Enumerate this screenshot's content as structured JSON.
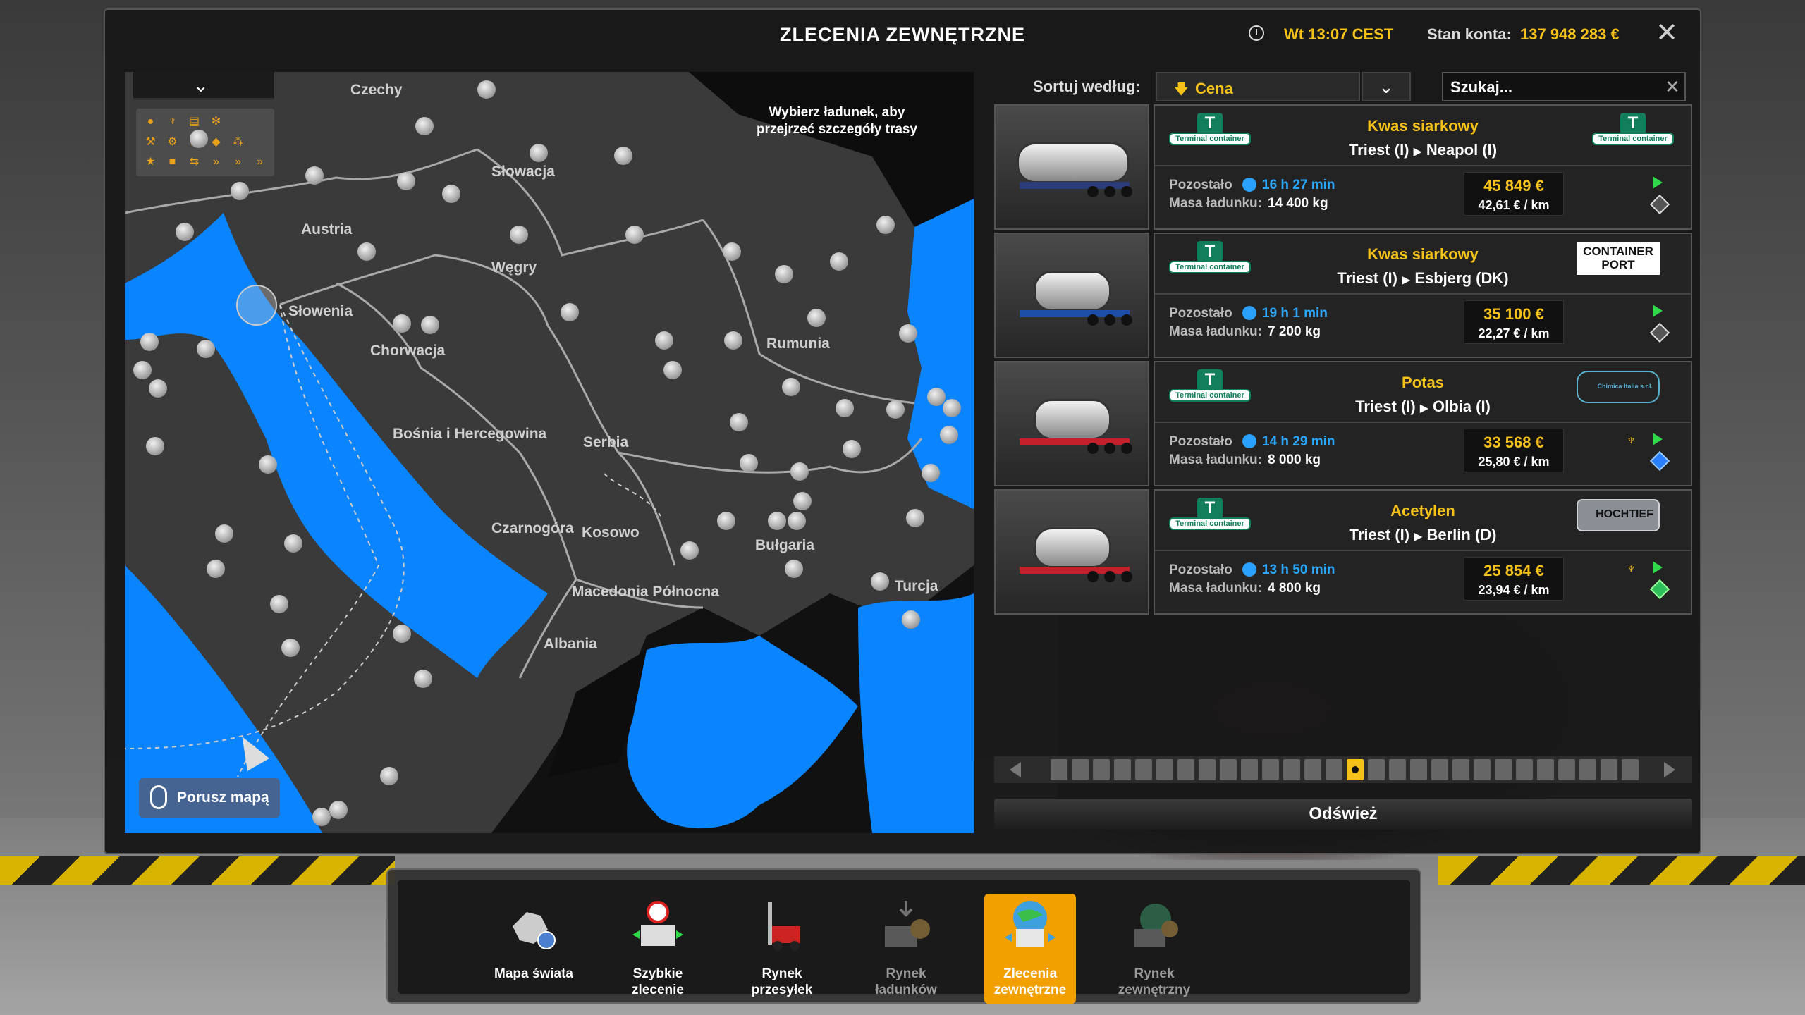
{
  "window": {
    "title": "ZLECENIA ZEWNĘTRZNE",
    "clock": "Wt 13:07 CEST",
    "balance_label": "Stan konta:",
    "balance_value": "137 948 283 €"
  },
  "map": {
    "hint": "Wybierz ładunek, aby przejrzeć szczegóły trasy",
    "move_label": "Porusz mapą",
    "labels": [
      {
        "name": "Czechy"
      },
      {
        "name": "Słowacja"
      },
      {
        "name": "Austria"
      },
      {
        "name": "Węgry"
      },
      {
        "name": "Słowenia"
      },
      {
        "name": "Chorwacja"
      },
      {
        "name": "Rumunia"
      },
      {
        "name": "Bośnia i Hercegowina"
      },
      {
        "name": "Serbia"
      },
      {
        "name": "Czarnogóra"
      },
      {
        "name": "Kosowo"
      },
      {
        "name": "Bułgaria"
      },
      {
        "name": "Macedonia Północna"
      },
      {
        "name": "Turcja"
      },
      {
        "name": "Albania"
      }
    ]
  },
  "sort": {
    "label": "Sortuj według:",
    "value": "Cena"
  },
  "search": {
    "placeholder": "Szukaj..."
  },
  "jobs": [
    {
      "cargo": "Kwas siarkowy",
      "from": "Triest (I)",
      "to": "Neapol (I)",
      "remaining_label": "Pozostało",
      "remaining": "16 h 27 min",
      "mass_label": "Masa ładunku:",
      "mass": "14 400 kg",
      "price": "45 849 €",
      "per_km": "42,61 € / km",
      "client_logo": "Terminal container",
      "dest_logo": "Terminal container"
    },
    {
      "cargo": "Kwas siarkowy",
      "from": "Triest (I)",
      "to": "Esbjerg (DK)",
      "remaining_label": "Pozostało",
      "remaining": "19 h 1 min",
      "mass_label": "Masa ładunku:",
      "mass": "7 200 kg",
      "price": "35 100 €",
      "per_km": "22,27 € / km",
      "client_logo": "Terminal container",
      "dest_logo": "CONTAINER PORT"
    },
    {
      "cargo": "Potas",
      "from": "Triest (I)",
      "to": "Olbia (I)",
      "remaining_label": "Pozostało",
      "remaining": "14 h 29 min",
      "mass_label": "Masa ładunku:",
      "mass": "8 000 kg",
      "price": "33 568 €",
      "per_km": "25,80 € / km",
      "client_logo": "Terminal container",
      "dest_logo": "Chimica Italia s.r.l."
    },
    {
      "cargo": "Acetylen",
      "from": "Triest (I)",
      "to": "Berlin (D)",
      "remaining_label": "Pozostało",
      "remaining": "13 h 50 min",
      "mass_label": "Masa ładunku:",
      "mass": "4 800 kg",
      "price": "25 854 €",
      "per_km": "23,94 € / km",
      "client_logo": "Terminal container",
      "dest_logo": "HOCHTIEF"
    }
  ],
  "refresh_label": "Odśwież",
  "pager": {
    "pages": 28,
    "current": 14
  },
  "bottom_nav": [
    {
      "label1": "Mapa świata",
      "label2": "",
      "icon": "world-map-icon"
    },
    {
      "label1": "Szybkie",
      "label2": "zlecenie",
      "icon": "quick-job-icon"
    },
    {
      "label1": "Rynek",
      "label2": "przesyłek",
      "icon": "freight-market-icon"
    },
    {
      "label1": "Rynek",
      "label2": "ładunków",
      "icon": "cargo-market-icon"
    },
    {
      "label1": "Zlecenia",
      "label2": "zewnętrzne",
      "icon": "external-contracts-icon"
    },
    {
      "label1": "Rynek",
      "label2": "zewnętrzny",
      "icon": "external-market-icon"
    }
  ],
  "colors": {
    "accent": "#f6c21a",
    "sea": "#0a84ff",
    "land": "#3a3a3a",
    "timer": "#2aa8ff"
  }
}
